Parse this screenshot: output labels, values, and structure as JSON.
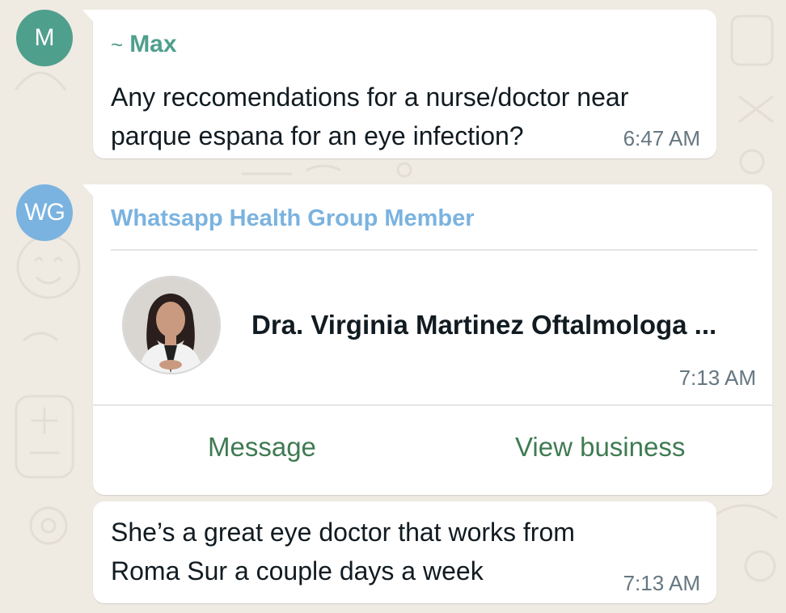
{
  "messages": [
    {
      "avatar_initials": "M",
      "sender_prefix": "~",
      "sender": "Max",
      "text": "Any reccomendations for a nurse/doctor near parque espana for an eye infection?",
      "time": "6:47 AM"
    },
    {
      "avatar_initials": "WG",
      "sender": "Whatsapp Health Group Member",
      "contact_card": {
        "name": "Dra. Virginia Martinez Oftalmologa ...",
        "time": "7:13 AM",
        "actions": [
          "Message",
          "View business"
        ]
      }
    },
    {
      "text": "She’s a great eye doctor that works from Roma Sur a couple days a week",
      "time": "7:13 AM"
    }
  ],
  "colors": {
    "background": "#efeae2",
    "max_name": "#4f9f8d",
    "wg_name": "#7ab3e0",
    "action_text": "#3f7b52",
    "timestamp": "#667781"
  }
}
